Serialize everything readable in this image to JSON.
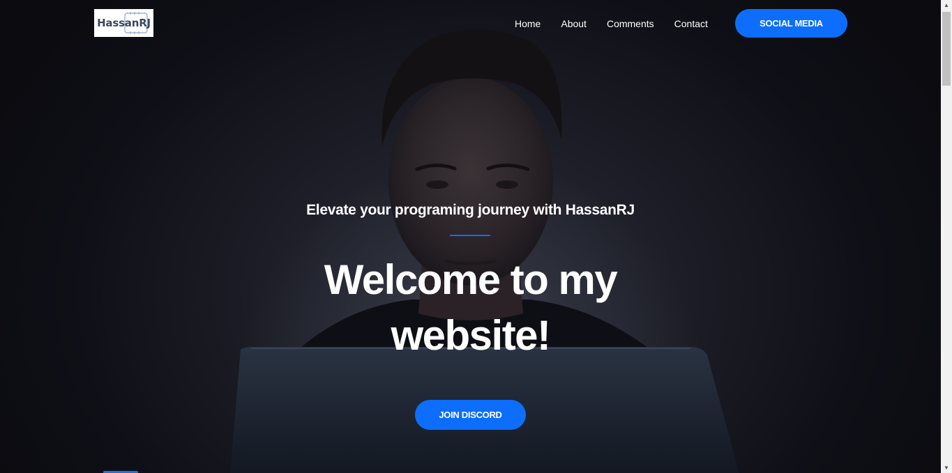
{
  "header": {
    "logo_text": "HassanRJ",
    "nav": [
      {
        "label": "Home"
      },
      {
        "label": "About"
      },
      {
        "label": "Comments"
      },
      {
        "label": "Contact"
      }
    ],
    "social_button": "SOCIAL MEDIA"
  },
  "hero": {
    "subtitle": "Elevate your programing journey with HassanRJ",
    "heading_line1": "Welcome to my",
    "heading_line2": "website!",
    "discord_button": "JOIN DISCORD"
  },
  "colors": {
    "accent": "#0d6efd",
    "background": "#0c0c12",
    "text": "#ffffff"
  }
}
